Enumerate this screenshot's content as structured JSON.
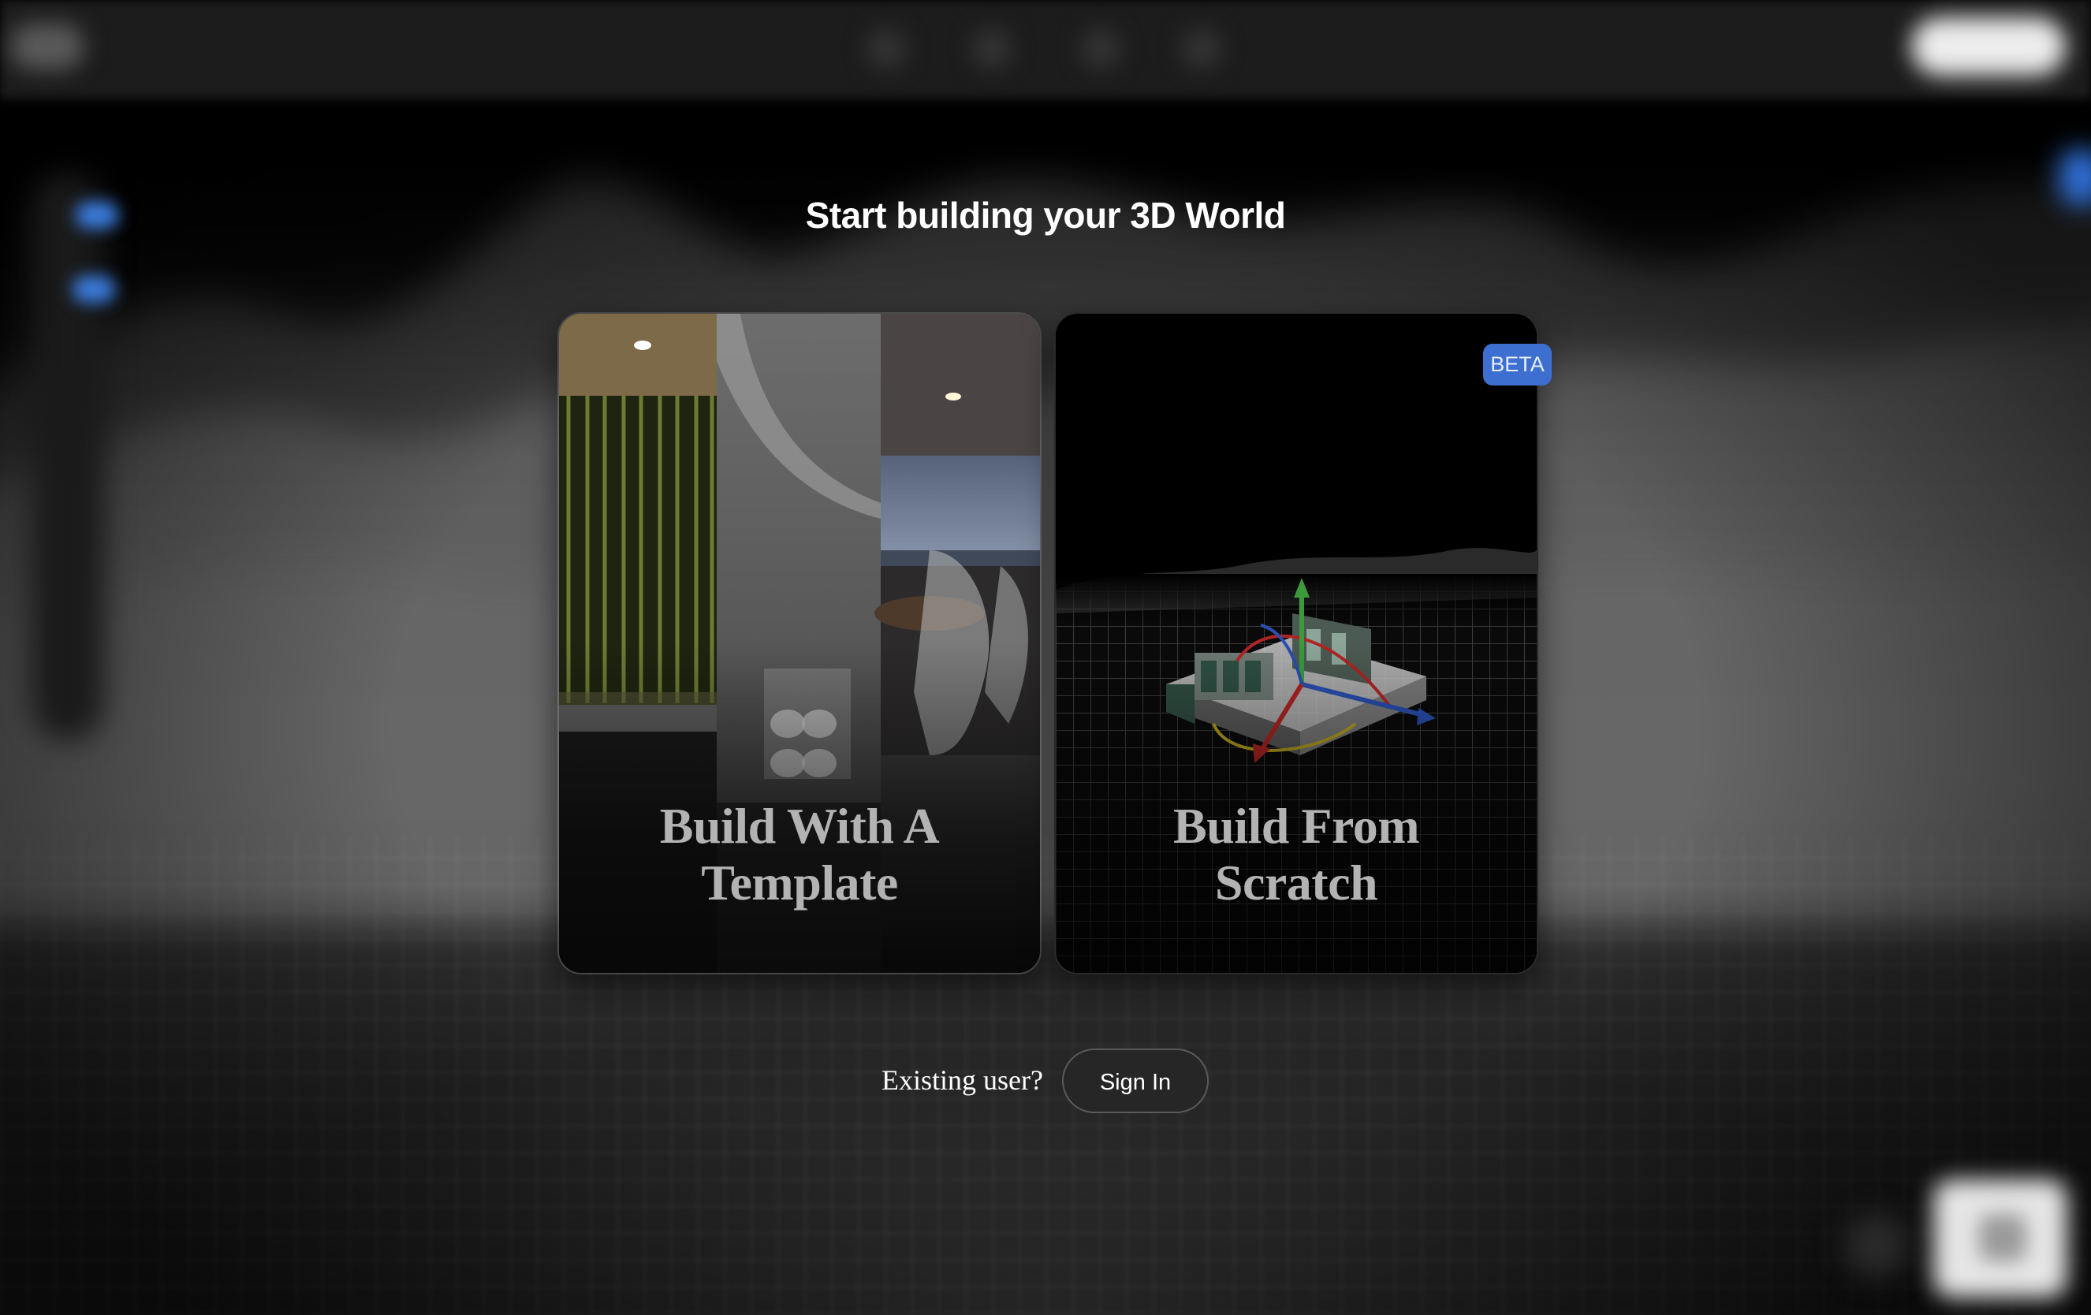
{
  "page": {
    "headline": "Start building your 3D World"
  },
  "cards": [
    {
      "id": "template",
      "title_line1": "Build With A",
      "title_line2": "Template"
    },
    {
      "id": "scratch",
      "title_line1": "Build From",
      "title_line2": "Scratch",
      "badge": "BETA"
    }
  ],
  "signin": {
    "prompt": "Existing user?",
    "button_label": "Sign In"
  },
  "colors": {
    "background": "#000000",
    "badge": "#3d6fd0",
    "card_title": "#b3b3b3",
    "button_bg": "#262626"
  },
  "icons": {
    "gizmo": "transform-gizmo-icon"
  }
}
